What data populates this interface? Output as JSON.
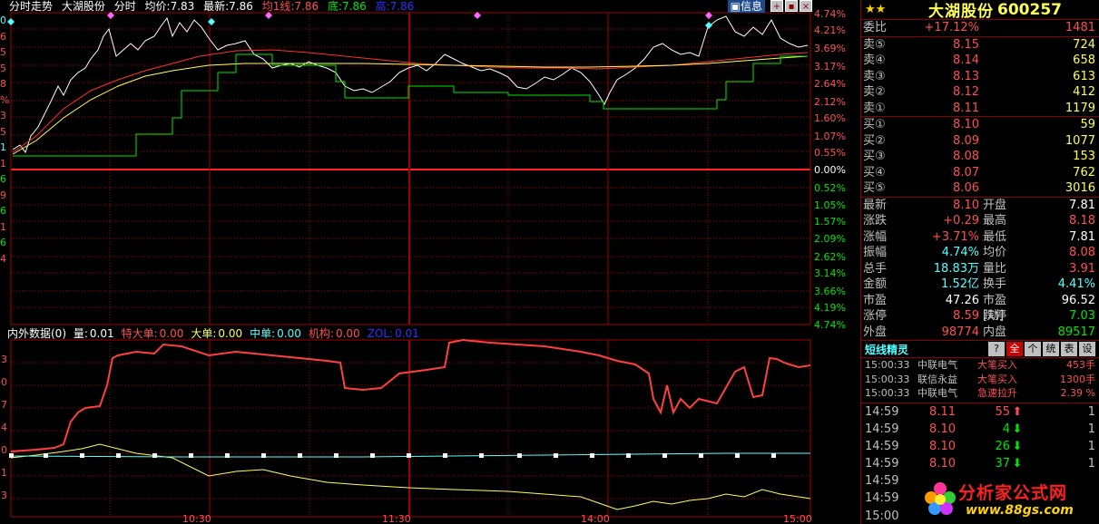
{
  "title_bar": {
    "window_label": "分时走势",
    "stock_name": "大湖股份",
    "mode": "分时",
    "avg_label": "均价:",
    "avg_value": "7.83",
    "last_label": "最新:",
    "last_value": "7.86",
    "ma_label": "均1线:",
    "ma_value": "7.86",
    "low_label": "底:",
    "low_value": "7.86",
    "high_label": "高:",
    "high_value": "7.86",
    "info_button": "信息"
  },
  "left_strip": [
    "0",
    "6",
    "5",
    "5",
    "8",
    "%",
    "3",
    "5",
    "1",
    "1",
    "6",
    "9",
    "6",
    "1",
    "6",
    "4"
  ],
  "price_axis": {
    "upper_pct": [
      "4.74%",
      "4.21%",
      "3.69%",
      "3.17%",
      "2.64%",
      "2.12%",
      "1.60%",
      "1.07%",
      "0.55%"
    ],
    "zero": "0.00%",
    "lower_pct": [
      "0.52%",
      "1.05%",
      "1.57%",
      "2.09%",
      "2.62%",
      "3.14%",
      "3.66%",
      "4.19%",
      "4.74%"
    ]
  },
  "sub_chart": {
    "title": "内外数据(0)",
    "items": [
      {
        "label": "量:",
        "value": "0.01",
        "color": "#ffffff"
      },
      {
        "label": "特大单:",
        "value": "0.00",
        "color": "#ff5050"
      },
      {
        "label": "大单:",
        "value": "0.00",
        "color": "#ffff54"
      },
      {
        "label": "中单:",
        "value": "0.00",
        "color": "#54ffff"
      },
      {
        "label": "机构:",
        "value": "0.00",
        "color": "#ff5050"
      },
      {
        "label": "ZOL:",
        "value": "0.01",
        "color": "#3030ff"
      }
    ],
    "left_labels": [
      "3",
      "0",
      "7",
      "4",
      "0",
      "1",
      "3"
    ]
  },
  "time_axis": [
    "10:30",
    "11:30",
    "14:00",
    "15:00"
  ],
  "panel": {
    "stars": "★★",
    "stock_name": "大湖股份",
    "stock_code": "600257",
    "weibi": {
      "label": "委比",
      "value": "+17.12%",
      "vol": "1481"
    },
    "asks": [
      {
        "label": "卖⑤",
        "price": "8.15",
        "vol": "724"
      },
      {
        "label": "卖④",
        "price": "8.14",
        "vol": "658"
      },
      {
        "label": "卖③",
        "price": "8.13",
        "vol": "613"
      },
      {
        "label": "卖②",
        "price": "8.12",
        "vol": "412"
      },
      {
        "label": "卖①",
        "price": "8.11",
        "vol": "1179"
      }
    ],
    "bids": [
      {
        "label": "买①",
        "price": "8.10",
        "vol": "59"
      },
      {
        "label": "买②",
        "price": "8.09",
        "vol": "1077"
      },
      {
        "label": "买③",
        "price": "8.08",
        "vol": "153"
      },
      {
        "label": "买④",
        "price": "8.07",
        "vol": "762"
      },
      {
        "label": "买⑤",
        "price": "8.06",
        "vol": "3016"
      }
    ],
    "quote": [
      {
        "l1": "最新",
        "v1": "8.10",
        "c1": "red",
        "l2": "开盘",
        "v2": "7.81",
        "c2": "white"
      },
      {
        "l1": "涨跌",
        "v1": "+0.29",
        "c1": "red",
        "l2": "最高",
        "v2": "8.18",
        "c2": "red"
      },
      {
        "l1": "涨幅",
        "v1": "+3.71%",
        "c1": "red",
        "l2": "最低",
        "v2": "7.81",
        "c2": "white"
      },
      {
        "l1": "振幅",
        "v1": "4.74%",
        "c1": "cyan",
        "l2": "均价",
        "v2": "8.08",
        "c2": "red"
      },
      {
        "l1": "总手",
        "v1": "18.83万",
        "c1": "cyan",
        "l2": "量比",
        "v2": "3.91",
        "c2": "red"
      },
      {
        "l1": "金额",
        "v1": "1.52亿",
        "c1": "cyan",
        "l2": "换手",
        "v2": "4.41%",
        "c2": "cyan"
      },
      {
        "l1": "市盈",
        "v1": "47.26",
        "c1": "white",
        "l2": "市盈[动]",
        "v2": "96.52",
        "c2": "white"
      },
      {
        "l1": "涨停",
        "v1": "8.59",
        "c1": "red",
        "l2": "跌停",
        "v2": "7.03",
        "c2": "green"
      },
      {
        "l1": "外盘",
        "v1": "98774",
        "c1": "red",
        "l2": "内盘",
        "v2": "89517",
        "c2": "green"
      }
    ],
    "wizard": {
      "title": "短线精灵",
      "buttons": [
        "?",
        "全",
        "个",
        "统",
        "表",
        "设"
      ],
      "rows": [
        {
          "time": "15:00:33",
          "name": "中联电气",
          "event": "大笔买入",
          "value": "453手"
        },
        {
          "time": "15:00:33",
          "name": "联信永益",
          "event": "大笔买入",
          "value": "1300手"
        },
        {
          "time": "15:00:33",
          "name": "中联电气",
          "event": "急速拉升",
          "value": "2.39 %"
        }
      ]
    },
    "ticks": [
      {
        "time": "14:59",
        "price": "8.11",
        "vol": "55",
        "dir": "up",
        "cnt": "1"
      },
      {
        "time": "14:59",
        "price": "8.10",
        "vol": "4",
        "dir": "down",
        "cnt": "1"
      },
      {
        "time": "14:59",
        "price": "8.10",
        "vol": "26",
        "dir": "down",
        "cnt": "1"
      },
      {
        "time": "14:59",
        "price": "8.10",
        "vol": "37",
        "dir": "down",
        "cnt": "1"
      },
      {
        "time": "14:59",
        "price": "",
        "vol": "",
        "dir": "",
        "cnt": ""
      },
      {
        "time": "14:59",
        "price": "",
        "vol": "",
        "dir": "",
        "cnt": ""
      },
      {
        "time": "15:00",
        "price": "",
        "vol": "",
        "dir": "",
        "cnt": ""
      }
    ]
  },
  "watermark": {
    "text": "分析家公式网",
    "url": "www.88gs.com"
  },
  "colors": {
    "grid": "#a00000",
    "price_line": "#ffffff",
    "avg_line": "#ff3030",
    "ma_line": "#ffff54",
    "green_line": "#00e600",
    "sub_red": "#ff4040",
    "sub_yellow": "#ffff54",
    "sub_cyan": "#54ffff"
  }
}
